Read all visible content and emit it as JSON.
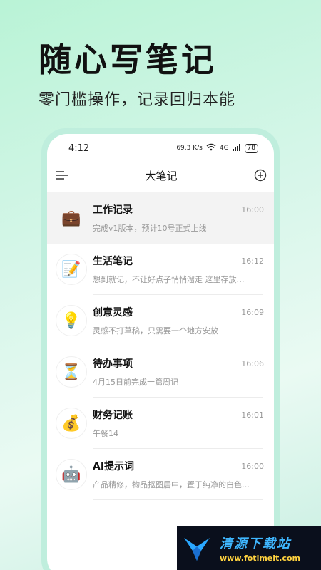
{
  "promo": {
    "title": "随心写笔记",
    "subtitle": "零门槛操作，记录回归本能"
  },
  "status_bar": {
    "time": "4:12",
    "net_speed": "69.3 K/s",
    "signal": "4G",
    "battery": "78"
  },
  "header": {
    "title": "大笔记",
    "menu_icon": "menu-icon",
    "add_icon": "add-circle-icon"
  },
  "notes": [
    {
      "title": "工作记录",
      "time": "16:00",
      "preview": "完成v1版本，预计10号正式上线",
      "icon": "💼",
      "icon_name": "briefcase-icon"
    },
    {
      "title": "生活笔记",
      "time": "16:12",
      "preview": "想到就记，不让好点子悄悄溜走 这里存放…",
      "icon": "📝",
      "icon_name": "memo-icon"
    },
    {
      "title": "创意灵感",
      "time": "16:09",
      "preview": "灵感不打草稿，只需要一个地方安放",
      "icon": "💡",
      "icon_name": "lightbulb-icon"
    },
    {
      "title": "待办事项",
      "time": "16:06",
      "preview": "4月15日前完成十篇周记",
      "icon": "⏳",
      "icon_name": "hourglass-icon"
    },
    {
      "title": "财务记账",
      "time": "16:01",
      "preview": "午餐14",
      "icon": "💰",
      "icon_name": "money-bag-icon"
    },
    {
      "title": "AI提示词",
      "time": "16:00",
      "preview": "产品精修，物品抠图居中，置于纯净的白色…",
      "icon": "🤖",
      "icon_name": "robot-icon"
    }
  ],
  "watermark": {
    "name": "清源下载站",
    "url": "www.fotimelt.com"
  },
  "colors": {
    "background_accent": "#b9f3d6",
    "text_primary": "#111111",
    "text_secondary": "#999999"
  }
}
